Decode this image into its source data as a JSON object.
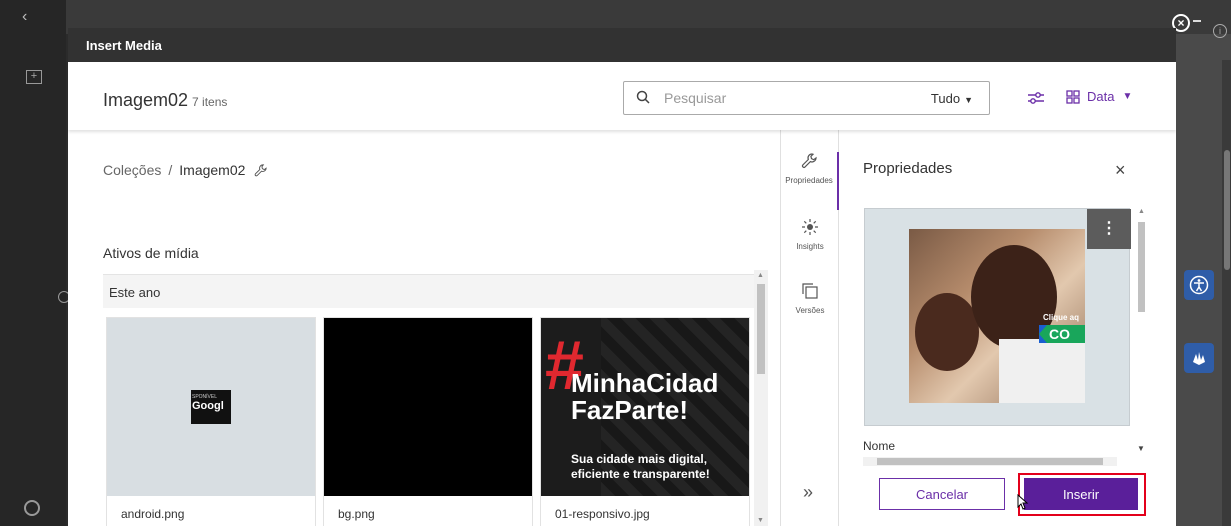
{
  "dialog": {
    "title": "Insert Media"
  },
  "header": {
    "folder_name": "Imagem02",
    "item_count": "7 itens",
    "search": {
      "placeholder": "Pesquisar",
      "value": ""
    },
    "scope": "Tudo",
    "view_label": "Data"
  },
  "breadcrumb": {
    "root": "Coleções",
    "separator": "/",
    "current": "Imagem02"
  },
  "assets": {
    "section_title": "Ativos de mídia",
    "group": "Este ano",
    "items": [
      {
        "name": "android.png",
        "thumb_line1": "SPONÍVEL",
        "thumb_line2": "Googl"
      },
      {
        "name": "bg.png"
      },
      {
        "name": "01-responsivo.jpg",
        "promo_hash": "#",
        "promo_line1": "MinhaCidad",
        "promo_line2": "FazParte!",
        "promo_sub1": "Sua cidade mais digital,",
        "promo_sub2": "eficiente e transparente!"
      }
    ]
  },
  "rail": {
    "items": [
      {
        "label": "Propriedades",
        "icon": "wrench-icon"
      },
      {
        "label": "Insights",
        "icon": "sun-icon"
      },
      {
        "label": "Versões",
        "icon": "versions-icon"
      }
    ],
    "expand": "»"
  },
  "properties": {
    "title": "Propriedades",
    "close": "×",
    "preview": {
      "cta_text": "Clique aq",
      "cta_label": "CO",
      "more": "⋮"
    },
    "name_label": "Nome"
  },
  "actions": {
    "cancel": "Cancelar",
    "insert": "Inserir"
  },
  "colors": {
    "accent": "#6b2fa8",
    "highlight": "#e3001b",
    "title_bar": "#323232"
  }
}
